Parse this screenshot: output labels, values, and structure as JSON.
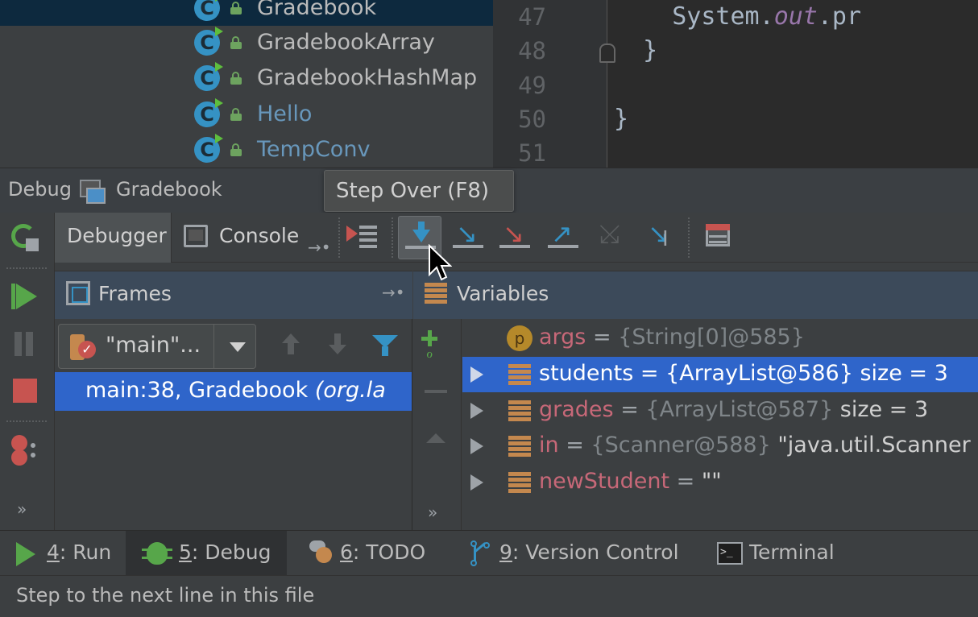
{
  "project_tree": {
    "items": [
      {
        "label": "Gradebook",
        "selected": true
      },
      {
        "label": "GradebookArray",
        "selected": false
      },
      {
        "label": "GradebookHashMap",
        "selected": false
      },
      {
        "label": "Hello",
        "selected": false
      },
      {
        "label": "TempConv",
        "selected": false
      }
    ],
    "class_icon_glyph": "C"
  },
  "editor": {
    "line_numbers": [
      "47",
      "48",
      "49",
      "50",
      "51"
    ],
    "lines": [
      {
        "pre": "    System.",
        "italic": "out",
        "post": ".pr"
      },
      {
        "pre": "  }",
        "italic": "",
        "post": ""
      },
      {
        "pre": "",
        "italic": "",
        "post": ""
      },
      {
        "pre": "}",
        "italic": "",
        "post": ""
      },
      {
        "pre": "",
        "italic": "",
        "post": ""
      }
    ]
  },
  "debug_window": {
    "title": "Debug",
    "config_name": "Gradebook",
    "tabs": {
      "debugger": "Debugger",
      "console": "Console"
    },
    "restore_glyph": "→•",
    "tooltip": "Step Over (F8)"
  },
  "frames": {
    "title": "Frames",
    "thread": "\"main\"...",
    "frame_label": "main:38, Gradebook",
    "frame_pkg": "(org.la"
  },
  "variables": {
    "title": "Variables",
    "rows": [
      {
        "name": "args",
        "eq": " = ",
        "value": "{String[0]@585}",
        "extra": "",
        "icon": "p",
        "expandable": false,
        "selected": false
      },
      {
        "name": "students",
        "eq": " = ",
        "value": "{ArrayList@586}",
        "extra": "  size = 3",
        "icon": "field",
        "expandable": true,
        "selected": true
      },
      {
        "name": "grades",
        "eq": " = ",
        "value": "{ArrayList@587}",
        "extra": "  size = 3",
        "icon": "field",
        "expandable": true,
        "selected": false
      },
      {
        "name": "in",
        "eq": " = ",
        "value": "{Scanner@588}",
        "extra": " \"java.util.Scanner",
        "icon": "field",
        "expandable": true,
        "selected": false
      },
      {
        "name": "newStudent",
        "eq": " = ",
        "value": "",
        "extra": "\"\"",
        "icon": "field",
        "expandable": true,
        "selected": false
      }
    ]
  },
  "more_glyph": "»",
  "bottom_tabs": [
    {
      "mnemonic": "4",
      "label": ": Run",
      "active": false
    },
    {
      "mnemonic": "5",
      "label": ": Debug",
      "active": true
    },
    {
      "mnemonic": "6",
      "label": ": TODO",
      "active": false
    },
    {
      "mnemonic": "9",
      "label": ": Version Control",
      "active": false
    },
    {
      "mnemonic": "",
      "label": "Terminal",
      "active": false
    }
  ],
  "terminal_icon_glyph": ">_",
  "status_text": "Step to the next line in this file",
  "colors": {
    "accent_selection": "#2f65ca",
    "run_green": "#57a64a",
    "stop_red": "#c75450",
    "step_blue": "#3592c4"
  }
}
